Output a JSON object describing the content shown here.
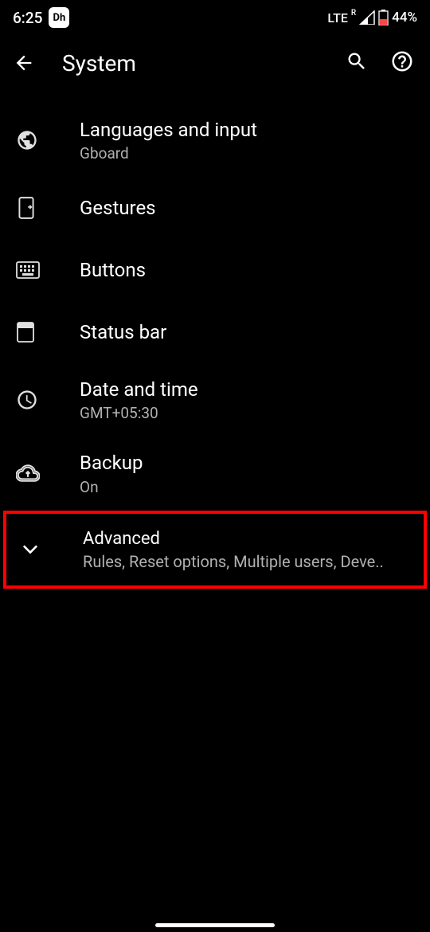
{
  "status": {
    "time": "6:25",
    "app_badge": "Dh",
    "network": "LTE",
    "roaming": "R",
    "battery_pct": "44%"
  },
  "header": {
    "title": "System"
  },
  "items": [
    {
      "title": "Languages and input",
      "subtitle": "Gboard"
    },
    {
      "title": "Gestures",
      "subtitle": ""
    },
    {
      "title": "Buttons",
      "subtitle": ""
    },
    {
      "title": "Status bar",
      "subtitle": ""
    },
    {
      "title": "Date and time",
      "subtitle": "GMT+05:30"
    },
    {
      "title": "Backup",
      "subtitle": "On"
    },
    {
      "title": "Advanced",
      "subtitle": "Rules, Reset options, Multiple users, Deve.."
    }
  ]
}
